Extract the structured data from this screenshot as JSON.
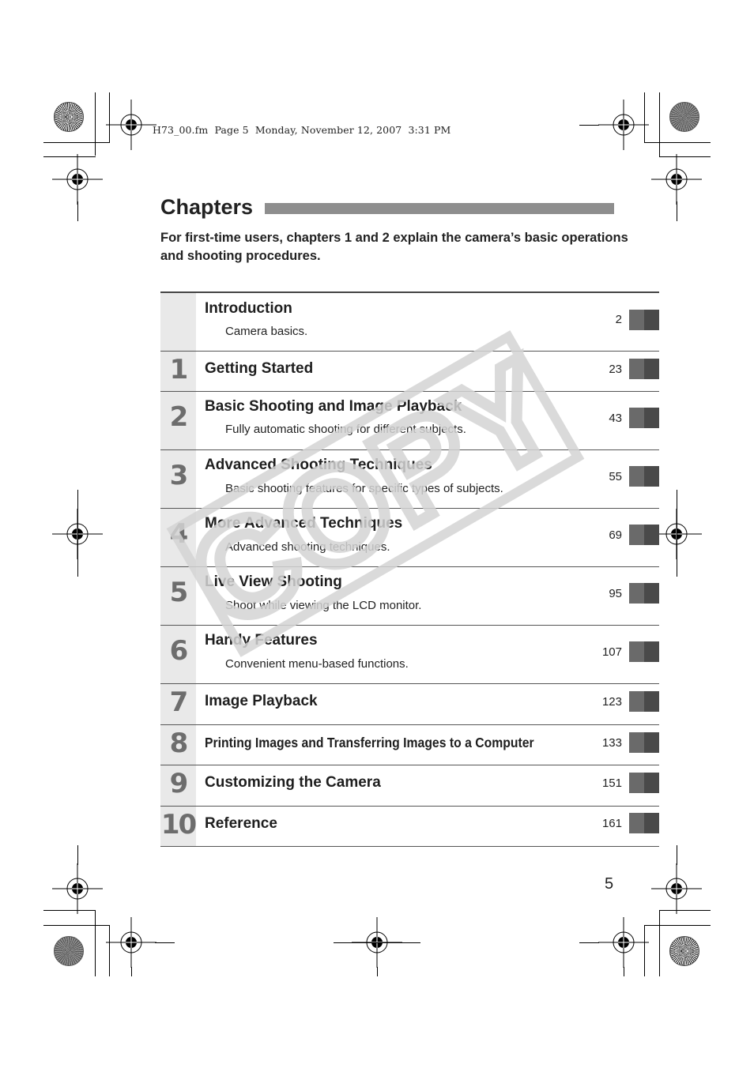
{
  "print_slug": "H73_00.fm  Page 5  Monday, November 12, 2007  3:31 PM",
  "heading": "Chapters",
  "intro": "For first-time users, chapters 1 and 2 explain the camera’s basic operations and shooting procedures.",
  "watermark": "COPY",
  "page_number": "5",
  "chapters": [
    {
      "number": "",
      "title": "Introduction",
      "description": "Camera basics.",
      "page": "2"
    },
    {
      "number": "1",
      "title": "Getting Started",
      "description": "",
      "page": "23"
    },
    {
      "number": "2",
      "title": "Basic Shooting and Image Playback",
      "description": "Fully automatic shooting for different subjects.",
      "page": "43"
    },
    {
      "number": "3",
      "title": "Advanced Shooting Techniques",
      "description": "Basic shooting features for specific types of subjects.",
      "page": "55"
    },
    {
      "number": "4",
      "title": "More Advanced Techniques",
      "description": "Advanced shooting techniques.",
      "page": "69"
    },
    {
      "number": "5",
      "title": "Live View Shooting",
      "description": "Shoot while viewing the LCD monitor.",
      "page": "95"
    },
    {
      "number": "6",
      "title": "Handy Features",
      "description": "Convenient menu-based functions.",
      "page": "107"
    },
    {
      "number": "7",
      "title": "Image Playback",
      "description": "",
      "page": "123"
    },
    {
      "number": "8",
      "title": "Printing Images and Transferring Images to a Computer",
      "description": "",
      "page": "133"
    },
    {
      "number": "9",
      "title": "Customizing the Camera",
      "description": "",
      "page": "151"
    },
    {
      "number": "10",
      "title": "Reference",
      "description": "",
      "page": "161"
    }
  ],
  "colors": {
    "title_bar": "#8e8e8e",
    "number_column": "#e9e9e9",
    "chapter_number": "#6d6d6d",
    "tab_light": "#6a6a6a",
    "tab_dark": "#4a4a4a",
    "watermark": "#d4d4d4"
  }
}
